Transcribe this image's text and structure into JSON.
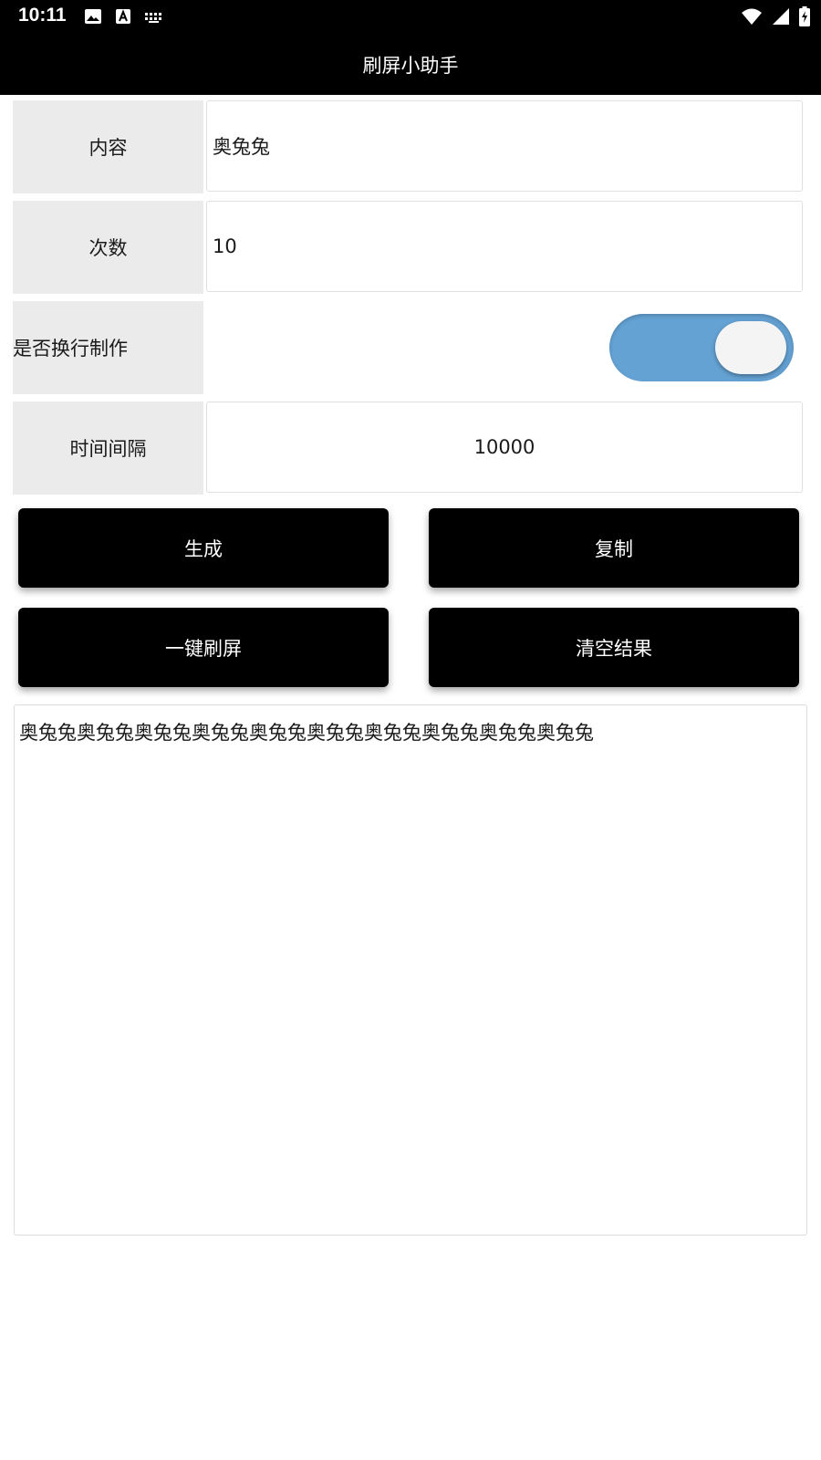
{
  "status_bar": {
    "time": "10:11",
    "left_icons": [
      "image-icon",
      "text-a-icon",
      "keyboard-icon"
    ],
    "right_icons": [
      "wifi-icon",
      "signal-icon",
      "battery-charging-icon"
    ]
  },
  "app_bar": {
    "title": "刷屏小助手"
  },
  "form": {
    "content": {
      "label": "内容",
      "value": "奥兔兔"
    },
    "count": {
      "label": "次数",
      "value": "10"
    },
    "newline": {
      "label": "是否换行制作",
      "enabled": true
    },
    "interval": {
      "label": "时间间隔",
      "value": "10000"
    }
  },
  "buttons": {
    "generate": "生成",
    "copy": "复制",
    "one_key_spam": "一键刷屏",
    "clear_result": "清空结果"
  },
  "result": {
    "text": "奥兔兔奥兔兔奥兔兔奥兔兔奥兔兔奥兔兔奥兔兔奥兔兔奥兔兔奥兔兔"
  },
  "colors": {
    "toggle_track": "#64a2d4",
    "bar_background": "#000000",
    "label_background": "#ebebeb"
  }
}
